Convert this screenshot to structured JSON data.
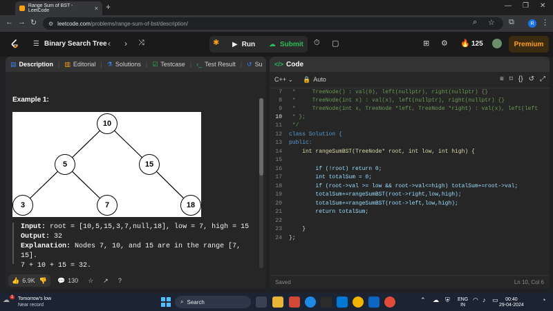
{
  "browser": {
    "tab_title": "Range Sum of BST - LeetCode",
    "tab_close": "×",
    "new_tab": "+",
    "url_host": "leetcode.com",
    "url_path": "/problems/range-sum-of-bst/description/",
    "profile_initial": "R"
  },
  "lc_nav": {
    "problem_list_title": "Binary Search Tree",
    "run_label": "Run",
    "submit_label": "Submit",
    "streak_count": "125",
    "premium_label": "Premium"
  },
  "left_tabs": [
    {
      "label": "Description"
    },
    {
      "label": "Editorial"
    },
    {
      "label": "Solutions"
    },
    {
      "label": "Testcase"
    },
    {
      "label": "Test Result"
    },
    {
      "label": "Su"
    }
  ],
  "example": {
    "title": "Example 1:",
    "tree_nodes": [
      "10",
      "5",
      "15",
      "3",
      "7",
      "18"
    ],
    "input_label": "Input:",
    "input_value": "root = [10,5,15,3,7,null,18], low = 7, high = 15",
    "output_label": "Output:",
    "output_value": "32",
    "explanation_label": "Explanation:",
    "explanation_line1": "Nodes 7, 10, and 15 are in the range [7, 15].",
    "explanation_line2": "7 + 10 + 15 = 32."
  },
  "reactions": {
    "likes": "6.9K",
    "comments": "130"
  },
  "editor": {
    "title": "Code",
    "language": "C++",
    "autosave": "Auto",
    "status_saved": "Saved",
    "cursor_pos": "Ln 10, Col 6",
    "lines": [
      {
        "no": "",
        "text": ""
      },
      {
        "no": "7",
        "text": " *     TreeNode() : val(0), left(nullptr), right(nullptr) {}"
      },
      {
        "no": "8",
        "text": " *     TreeNode(int x) : val(x), left(nullptr), right(nullptr) {}"
      },
      {
        "no": "9",
        "text": " *     TreeNode(int x, TreeNode *left, TreeNode *right) : val(x), left(left"
      },
      {
        "no": "10",
        "text": " * };"
      },
      {
        "no": "11",
        "text": " */"
      },
      {
        "no": "12",
        "text": "class Solution {"
      },
      {
        "no": "13",
        "text": "public:"
      },
      {
        "no": "14",
        "text": "    int rangeSumBST(TreeNode* root, int low, int high) {"
      },
      {
        "no": "15",
        "text": ""
      },
      {
        "no": "16",
        "text": "        if (!root) return 0;"
      },
      {
        "no": "17",
        "text": "        int totalSum = 0;"
      },
      {
        "no": "18",
        "text": "        if (root->val >= low && root->val<=high) totalSum+=root->val;"
      },
      {
        "no": "19",
        "text": "        totalSum+=rangeSumBST(root->right,low,high);"
      },
      {
        "no": "20",
        "text": "        totalSum+=rangeSumBST(root->left,low,high);"
      },
      {
        "no": "21",
        "text": "        return totalSum;"
      },
      {
        "no": "22",
        "text": ""
      },
      {
        "no": "23",
        "text": "    }"
      },
      {
        "no": "24",
        "text": "};"
      }
    ]
  },
  "taskbar": {
    "weather_title": "Tomorrow's low",
    "weather_sub": "Near record",
    "weather_badge": "1",
    "search_label": "Search",
    "lang_line1": "ENG",
    "lang_line2": "IN",
    "time": "00:40",
    "date": "29-04-2024"
  },
  "colors": {
    "accent_green": "#2cbb5d",
    "accent_orange": "#ffa116",
    "panel_bg": "#262626"
  }
}
